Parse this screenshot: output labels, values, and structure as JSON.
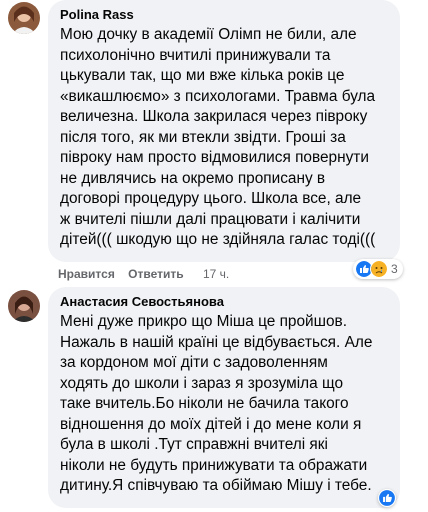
{
  "comments": [
    {
      "author": "Polina Rass",
      "lines": [
        "Мою дочку в академії Олімп не били, але",
        "психолонічно вчитилі принижували та",
        "цькували так, що ми вже кілька років це",
        "«викашлюємо» з психологами. Травма була",
        "величезна. Школа закрилася через півроку",
        "після того, як ми втекли звідти. Гроші за",
        "півроку нам просто відмовилися повернути",
        "не дивлячись на окремо прописану в",
        "договорі процедуру цього. Школа все, але",
        "ж вчителі пішли далі працювати і калічити",
        "дітей((( шкодую що не здійняла галас тоді((("
      ],
      "actions": {
        "like": "Нравится",
        "reply": "Ответить",
        "time": "17 ч."
      },
      "reactions": {
        "icons": [
          "like-icon",
          "sad-icon"
        ],
        "count": "3"
      }
    },
    {
      "author": "Анастасия Севостьянова",
      "lines": [
        "Мені дуже прикро що Міша це пройшов.",
        "Нажаль в нашій країні це відбувається. Але",
        "за кордоном мої діти с задоволенням",
        "ходять до школи і зараз я зрозуміла що",
        "таке вчитель.Бо ніколи не бачила такого",
        "відношення до моїх дітей і до мене коли я",
        "була в школі .Тут справжні вчителі які",
        "ніколи не будуть принижувати та ображати",
        "дитину.Я співчуваю та обіймаю Мішу і тебе."
      ],
      "reactions": {
        "icons": [
          "like-icon"
        ]
      }
    }
  ],
  "colors": {
    "bubble": "#f0f2f5",
    "text": "#050505",
    "meta": "#65676b",
    "like": "#1877f2",
    "sad": "#f7b125"
  }
}
